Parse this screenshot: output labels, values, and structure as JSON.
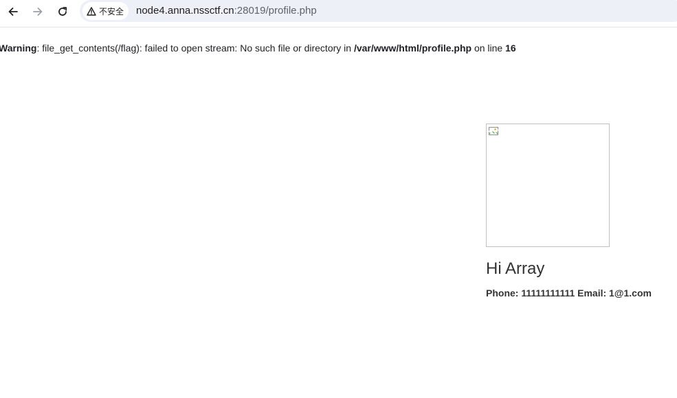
{
  "browser": {
    "security_label": "不安全",
    "url_host": "node4.anna.nssctf.cn",
    "url_rest": ":28019/profile.php",
    "icons": {
      "back": "arrow-left-icon",
      "forward": "arrow-right-icon",
      "reload": "reload-icon",
      "security": "warning-triangle-icon"
    }
  },
  "warning": {
    "label": "Warning",
    "message": ": file_get_contents(/flag): failed to open stream: No such file or directory in ",
    "path": "/var/www/html/profile.php",
    "line_text": " on line ",
    "line_number": "16"
  },
  "profile": {
    "avatar_icon": "broken-image-icon",
    "greeting": "Hi Array",
    "contact": "Phone: 11111111111 Email: 1@1.com"
  }
}
